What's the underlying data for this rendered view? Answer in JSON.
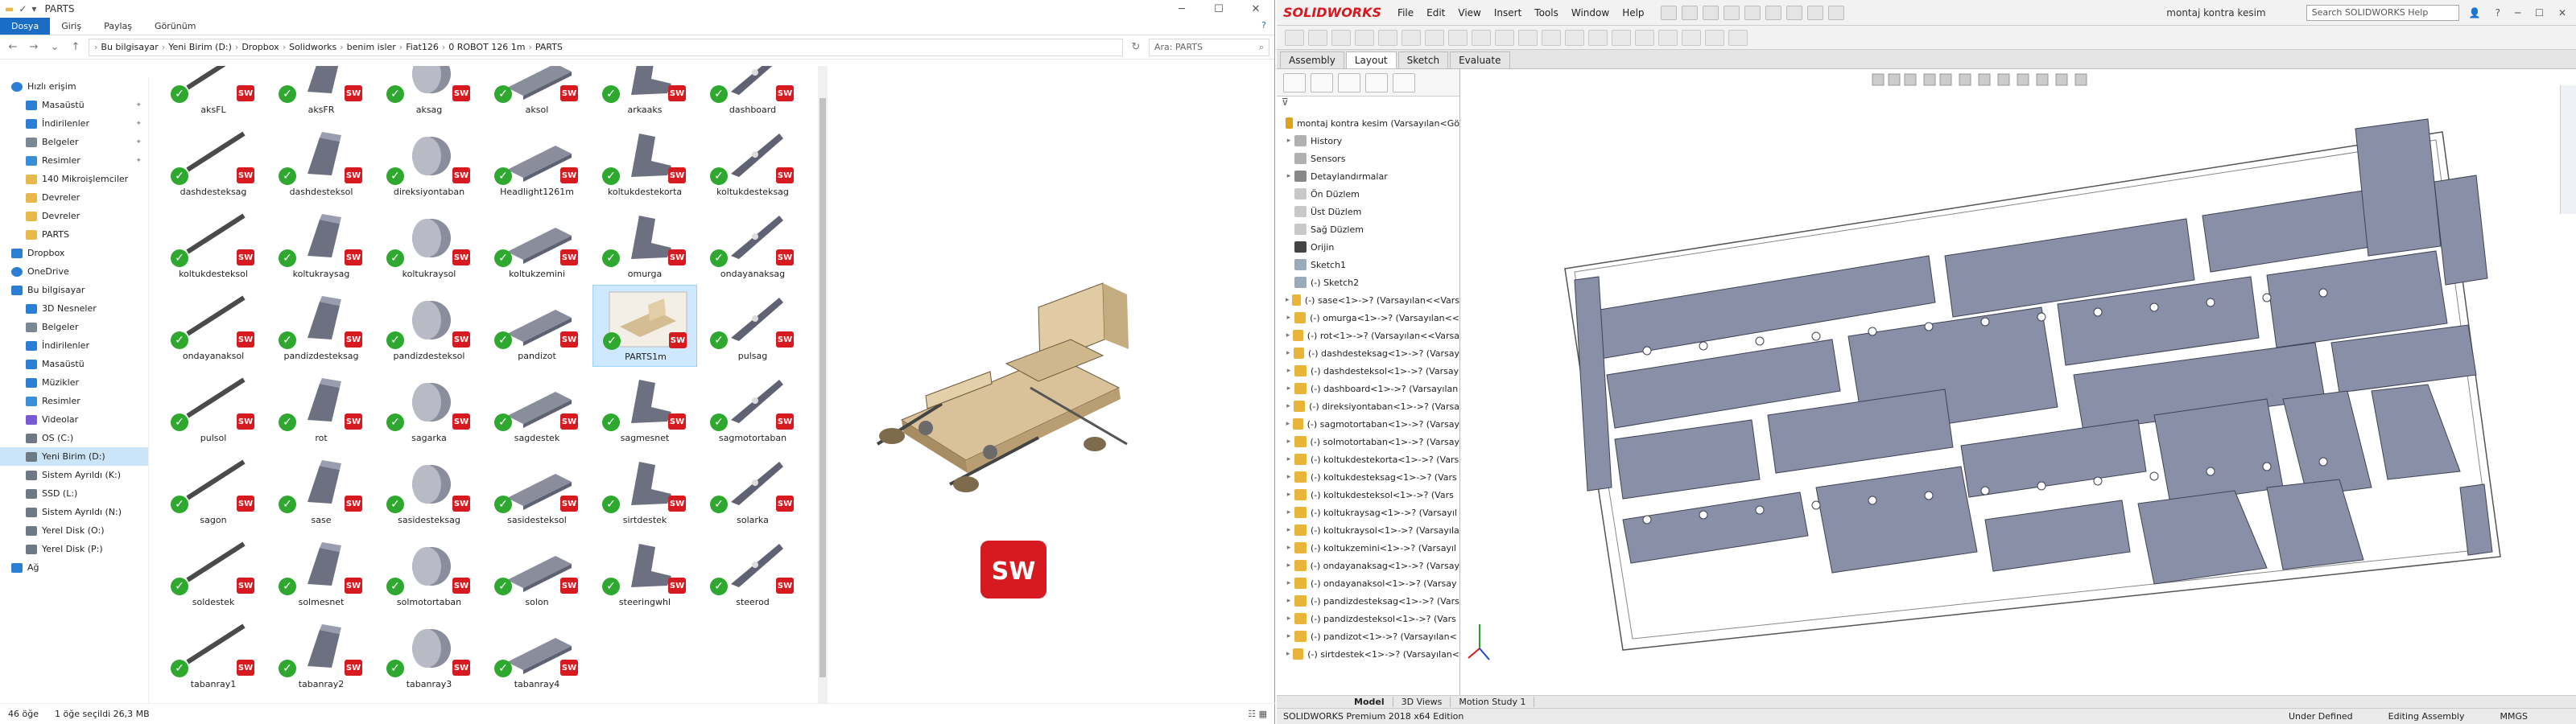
{
  "explorer": {
    "title": "PARTS",
    "ribbon_tabs": [
      "Dosya",
      "Giriş",
      "Paylaş",
      "Görünüm"
    ],
    "breadcrumb": [
      "Bu bilgisayar",
      "Yeni Birim (D:)",
      "Dropbox",
      "Solidworks",
      "benim isler",
      "Fiat126",
      "0 ROBOT 126 1m",
      "PARTS"
    ],
    "search_placeholder": "Ara: PARTS",
    "nav": [
      {
        "label": "Hızlı erişim",
        "indent": 0,
        "icon": "star-icon",
        "color": "#2a7fd4",
        "pin": false
      },
      {
        "label": "Masaüstü",
        "indent": 1,
        "icon": "folder-icon",
        "color": "#2a7fd4",
        "pin": true
      },
      {
        "label": "İndirilenler",
        "indent": 1,
        "icon": "download-icon",
        "color": "#2a7fd4",
        "pin": true
      },
      {
        "label": "Belgeler",
        "indent": 1,
        "icon": "document-icon",
        "color": "#7a8794",
        "pin": true
      },
      {
        "label": "Resimler",
        "indent": 1,
        "icon": "picture-icon",
        "color": "#3a8fd9",
        "pin": true
      },
      {
        "label": "140 Mikroişlemciler",
        "indent": 1,
        "icon": "folder-icon",
        "color": "#e8b84a",
        "pin": false
      },
      {
        "label": "Devreler",
        "indent": 1,
        "icon": "folder-icon",
        "color": "#e8b84a",
        "pin": false
      },
      {
        "label": "Devreler",
        "indent": 1,
        "icon": "folder-icon",
        "color": "#e8b84a",
        "pin": false
      },
      {
        "label": "PARTS",
        "indent": 1,
        "icon": "folder-icon",
        "color": "#e8b84a",
        "pin": false
      },
      {
        "label": "Dropbox",
        "indent": 0,
        "icon": "dropbox-icon",
        "color": "#2a7fd4",
        "pin": false
      },
      {
        "label": "OneDrive",
        "indent": 0,
        "icon": "cloud-icon",
        "color": "#2a7fd4",
        "pin": false
      },
      {
        "label": "Bu bilgisayar",
        "indent": 0,
        "icon": "computer-icon",
        "color": "#2a7fd4",
        "pin": false
      },
      {
        "label": "3D Nesneler",
        "indent": 1,
        "icon": "cube-icon",
        "color": "#2a7fd4",
        "pin": false
      },
      {
        "label": "Belgeler",
        "indent": 1,
        "icon": "document-icon",
        "color": "#7a8794",
        "pin": false
      },
      {
        "label": "İndirilenler",
        "indent": 1,
        "icon": "download-icon",
        "color": "#2a7fd4",
        "pin": false
      },
      {
        "label": "Masaüstü",
        "indent": 1,
        "icon": "folder-icon",
        "color": "#2a7fd4",
        "pin": false
      },
      {
        "label": "Müzikler",
        "indent": 1,
        "icon": "music-icon",
        "color": "#2a7fd4",
        "pin": false
      },
      {
        "label": "Resimler",
        "indent": 1,
        "icon": "picture-icon",
        "color": "#3a8fd9",
        "pin": false
      },
      {
        "label": "Videolar",
        "indent": 1,
        "icon": "video-icon",
        "color": "#7a5ad4",
        "pin": false
      },
      {
        "label": "OS (C:)",
        "indent": 1,
        "icon": "drive-icon",
        "color": "#6d7a86",
        "pin": false
      },
      {
        "label": "Yeni Birim (D:)",
        "indent": 1,
        "icon": "drive-icon",
        "color": "#6d7a86",
        "pin": false,
        "selected": true
      },
      {
        "label": "Sistem Ayrıldı (K:)",
        "indent": 1,
        "icon": "drive-icon",
        "color": "#6d7a86",
        "pin": false
      },
      {
        "label": "SSD (L:)",
        "indent": 1,
        "icon": "drive-icon",
        "color": "#6d7a86",
        "pin": false
      },
      {
        "label": "Sistem Ayrıldı (N:)",
        "indent": 1,
        "icon": "drive-icon",
        "color": "#6d7a86",
        "pin": false
      },
      {
        "label": "Yerel Disk (O:)",
        "indent": 1,
        "icon": "drive-icon",
        "color": "#6d7a86",
        "pin": false
      },
      {
        "label": "Yerel Disk (P:)",
        "indent": 1,
        "icon": "drive-icon",
        "color": "#6d7a86",
        "pin": false
      },
      {
        "label": "Ağ",
        "indent": 0,
        "icon": "network-icon",
        "color": "#2a7fd4",
        "pin": false
      }
    ],
    "files": [
      "aksFL",
      "aksFR",
      "aksag",
      "aksol",
      "arkaaks",
      "dashboard",
      "dashdesteksag",
      "dashdesteksol",
      "direksiyontaban",
      "Headlight1261m",
      "koltukdestekorta",
      "koltukdesteksag",
      "koltukdesteksol",
      "koltukraysag",
      "koltukraysol",
      "koltukzemini",
      "omurga",
      "ondayanaksag",
      "ondayanaksol",
      "pandizdesteksag",
      "pandizdesteksol",
      "pandizot",
      "PARTS1m",
      "pulsag",
      "pulsol",
      "rot",
      "sagarka",
      "sagdestek",
      "sagmesnet",
      "sagmotortaban",
      "sagon",
      "sase",
      "sasidesteksag",
      "sasidesteksol",
      "sirtdestek",
      "solarka",
      "soldestek",
      "solmesnet",
      "solmotortaban",
      "solon",
      "steeringwhl",
      "steerod",
      "tabanray1",
      "tabanray2",
      "tabanray3",
      "tabanray4"
    ],
    "selected_file": "PARTS1m",
    "sw_badge": "SW",
    "status_count": "46 öğe",
    "status_selected": "1 öğe seçildi  26,3 MB"
  },
  "solidworks": {
    "brand": "SOLIDWORKS",
    "menu": [
      "File",
      "Edit",
      "View",
      "Insert",
      "Tools",
      "Window",
      "Help"
    ],
    "doc_title": "montaj kontra kesim",
    "search_help": "Search SOLIDWORKS Help",
    "tabs": [
      "Assembly",
      "Layout",
      "Sketch",
      "Evaluate"
    ],
    "active_tab": "Layout",
    "tree": [
      {
        "label": "montaj kontra kesim  (Varsayılan<Gö",
        "expand": false,
        "kind": "assembly"
      },
      {
        "label": "History",
        "expand": true,
        "kind": "folder"
      },
      {
        "label": "Sensors",
        "expand": false,
        "kind": "folder"
      },
      {
        "label": "Detaylandırmalar",
        "expand": true,
        "kind": "annotation"
      },
      {
        "label": "Ön Düzlem",
        "expand": false,
        "kind": "plane"
      },
      {
        "label": "Üst Düzlem",
        "expand": false,
        "kind": "plane"
      },
      {
        "label": "Sağ Düzlem",
        "expand": false,
        "kind": "plane"
      },
      {
        "label": "Orijin",
        "expand": false,
        "kind": "origin"
      },
      {
        "label": "Sketch1",
        "expand": false,
        "kind": "sketch"
      },
      {
        "label": "(-) Sketch2",
        "expand": false,
        "kind": "sketch"
      },
      {
        "label": "(-) sase<1>->? (Varsayılan<<Vars",
        "expand": true,
        "kind": "part"
      },
      {
        "label": "(-) omurga<1>->? (Varsayılan<<",
        "expand": true,
        "kind": "part"
      },
      {
        "label": "(-) rot<1>->? (Varsayılan<<Varsa",
        "expand": true,
        "kind": "part"
      },
      {
        "label": "(-) dashdesteksag<1>->? (Varsay",
        "expand": true,
        "kind": "part"
      },
      {
        "label": "(-) dashdesteksol<1>->? (Varsay",
        "expand": true,
        "kind": "part"
      },
      {
        "label": "(-) dashboard<1>->? (Varsayılan",
        "expand": true,
        "kind": "part"
      },
      {
        "label": "(-) direksiyontaban<1>->? (Varsa",
        "expand": true,
        "kind": "part"
      },
      {
        "label": "(-) sagmotortaban<1>->? (Varsay",
        "expand": true,
        "kind": "part"
      },
      {
        "label": "(-) solmotortaban<1>->? (Varsay",
        "expand": true,
        "kind": "part"
      },
      {
        "label": "(-) koltukdestekorta<1>->? (Vars",
        "expand": true,
        "kind": "part"
      },
      {
        "label": "(-) koltukdesteksag<1>->? (Vars",
        "expand": true,
        "kind": "part"
      },
      {
        "label": "(-) koltukdesteksol<1>->? (Vars",
        "expand": true,
        "kind": "part"
      },
      {
        "label": "(-) koltukraysag<1>->? (Varsayıl",
        "expand": true,
        "kind": "part"
      },
      {
        "label": "(-) koltukraysol<1>->? (Varsayıla",
        "expand": true,
        "kind": "part"
      },
      {
        "label": "(-) koltukzemini<1>->? (Varsayıl",
        "expand": true,
        "kind": "part"
      },
      {
        "label": "(-) ondayanaksag<1>->? (Varsay",
        "expand": true,
        "kind": "part"
      },
      {
        "label": "(-) ondayanaksol<1>->? (Varsay",
        "expand": true,
        "kind": "part"
      },
      {
        "label": "(-) pandizdesteksag<1>->? (Vars",
        "expand": true,
        "kind": "part"
      },
      {
        "label": "(-) pandizdesteksol<1>->? (Vars",
        "expand": true,
        "kind": "part"
      },
      {
        "label": "(-) pandizot<1>->? (Varsayılan<",
        "expand": true,
        "kind": "part"
      },
      {
        "label": "(-) sirtdestek<1>->? (Varsayılan<",
        "expand": true,
        "kind": "part"
      }
    ],
    "bottom_tabs": [
      "Model",
      "3D Views",
      "Motion Study 1"
    ],
    "status_left": "SOLIDWORKS Premium 2018 x64 Edition",
    "status_right": [
      "Under Defined",
      "Editing Assembly",
      "MMGS"
    ],
    "part_color": "#8a8fa8",
    "accent": "#d71920"
  }
}
